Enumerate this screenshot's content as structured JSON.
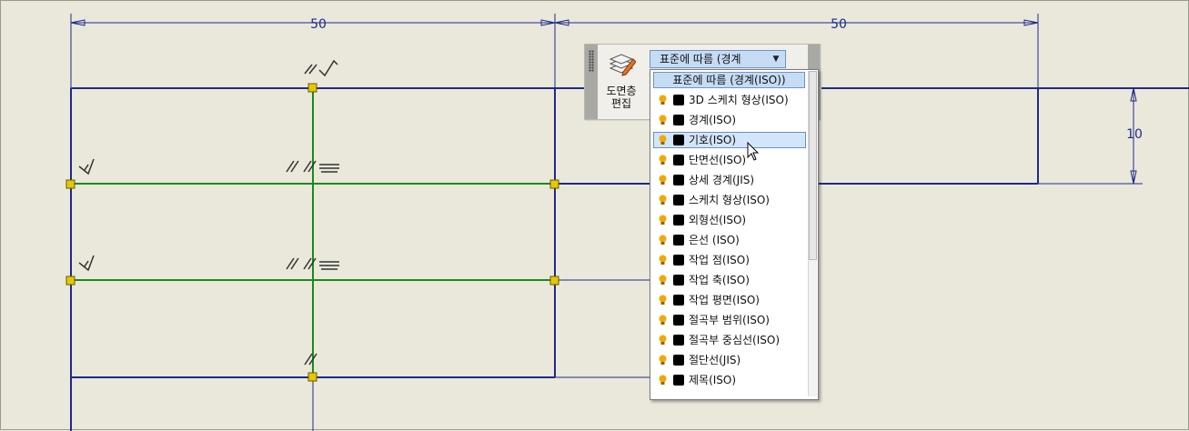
{
  "dimensions": {
    "left_width": "50",
    "right_width": "50",
    "right_height": "10"
  },
  "panel": {
    "edit_layers_line1": "도면층",
    "edit_layers_line2": "편집",
    "selected_layer": "표준에 따름 (경계"
  },
  "dropdown": {
    "header": "표준에 따름 (경계(ISO))",
    "selected_index": 2,
    "items": [
      {
        "label": "3D 스케치 형상(ISO)",
        "color": "#000000"
      },
      {
        "label": "경계(ISO)",
        "color": "#000000"
      },
      {
        "label": "기호(ISO)",
        "color": "#000000"
      },
      {
        "label": "단면선(ISO)",
        "color": "#000000"
      },
      {
        "label": "상세 경계(JIS)",
        "color": "#000000"
      },
      {
        "label": "스케치 형상(ISO)",
        "color": "#000000"
      },
      {
        "label": "외형선(ISO)",
        "color": "#000000"
      },
      {
        "label": "은선 (ISO)",
        "color": "#000000"
      },
      {
        "label": "작업 점(ISO)",
        "color": "#000000"
      },
      {
        "label": "작업 축(ISO)",
        "color": "#000000"
      },
      {
        "label": "작업 평면(ISO)",
        "color": "#000000"
      },
      {
        "label": "절곡부 범위(ISO)",
        "color": "#000000"
      },
      {
        "label": "절곡부 중심선(ISO)",
        "color": "#000000"
      },
      {
        "label": "절단선(JIS)",
        "color": "#000000"
      },
      {
        "label": "제목(ISO)",
        "color": "#000000"
      }
    ]
  },
  "colors": {
    "geometry_blue": "#1e2a8a",
    "sketch_green": "#1a8a1a",
    "constraint_point": "#e6c800",
    "bulb": "#f2a800",
    "highlight": "#c6dcf4"
  },
  "icons": {
    "edit_layers": "layers-pencil-icon",
    "layer_visible": "lightbulb-icon",
    "dropdown_arrow": "chevron-down-icon",
    "cursor": "arrow-cursor-icon"
  }
}
